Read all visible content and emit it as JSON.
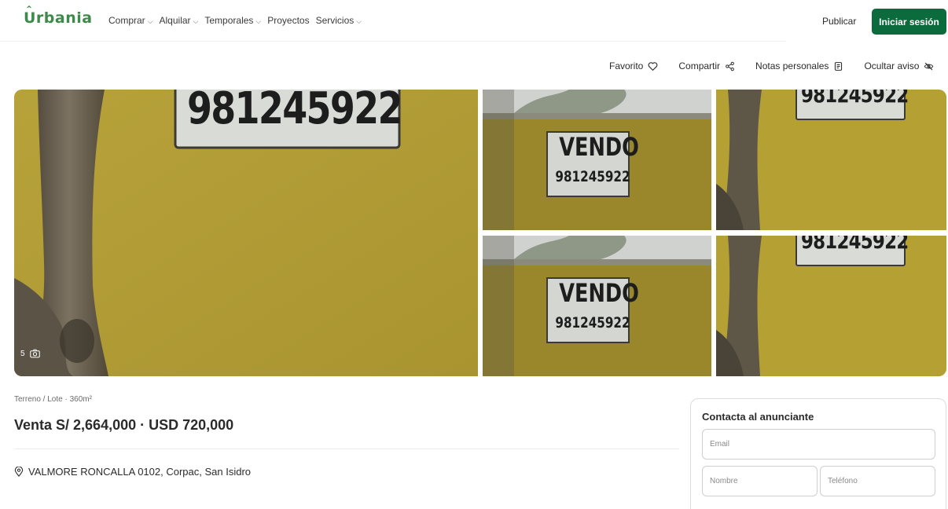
{
  "header": {
    "logo": "Urbania",
    "nav": [
      {
        "label": "Comprar",
        "dropdown": true
      },
      {
        "label": "Alquilar",
        "dropdown": true
      },
      {
        "label": "Temporales",
        "dropdown": true
      },
      {
        "label": "Proyectos",
        "dropdown": false
      },
      {
        "label": "Servicios",
        "dropdown": true
      }
    ],
    "publish_label": "Publicar",
    "login_label": "Iniciar sesión"
  },
  "actions": {
    "favorite": "Favorito",
    "share": "Compartir",
    "notes": "Notas personales",
    "hide": "Ocultar aviso"
  },
  "gallery": {
    "photo_count": "5",
    "phone_on_sign": "981245922",
    "sign_word": "VENDO"
  },
  "listing": {
    "property_type": "Terreno / Lote · 360m²",
    "price": "Venta S/ 2,664,000 · USD 720,000",
    "address": "VALMORE RONCALLA 0102, Corpac, San Isidro"
  },
  "contact": {
    "title": "Contacta al anunciante",
    "email_placeholder": "Email",
    "name_placeholder": "Nombre",
    "phone_placeholder": "Teléfono"
  },
  "colors": {
    "brand_green": "#3d8a4a",
    "login_button": "#0b6b3d",
    "wall_yellow": "#b8a334"
  }
}
